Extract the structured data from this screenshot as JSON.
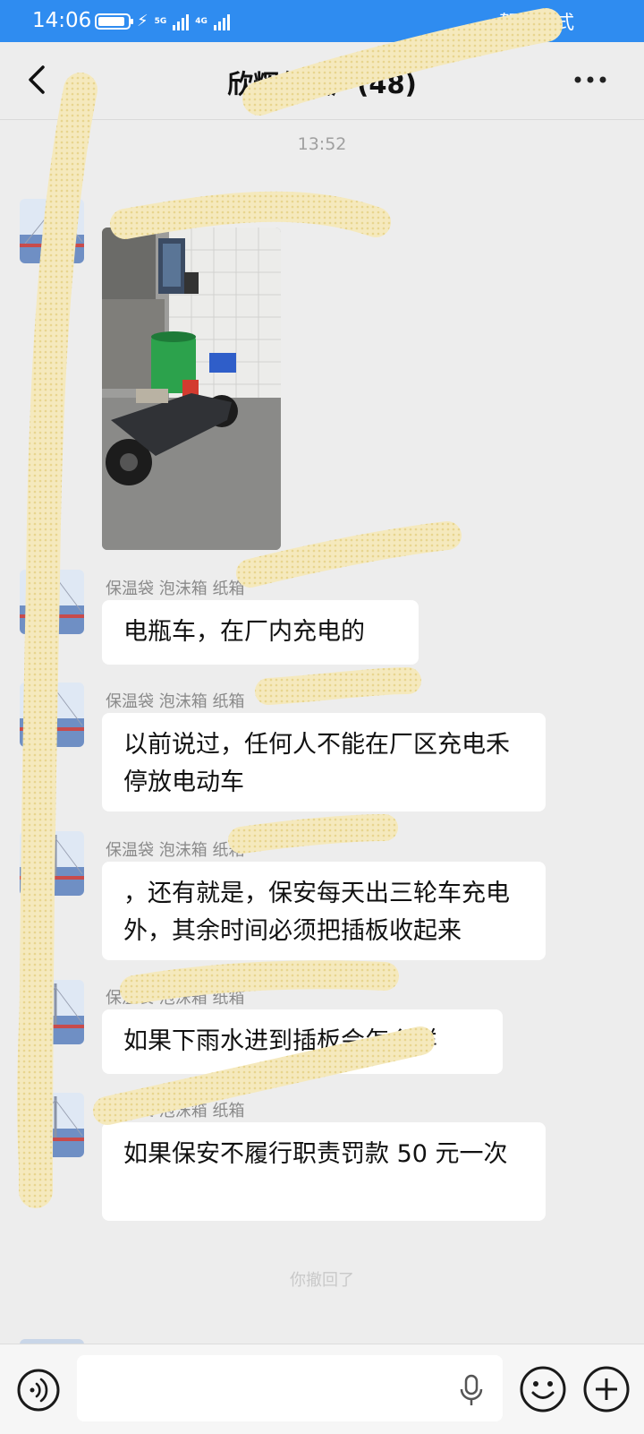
{
  "status_bar": {
    "time": "14:06",
    "network_1": "5G",
    "network_2": "4G",
    "mode": "驾驶模式"
  },
  "header": {
    "title": "欣辉包装厂(48)"
  },
  "chat": {
    "timestamp": "13:52",
    "sender_name": "保温袋 泡沫箱 纸箱",
    "messages": [
      {
        "text": "电瓶车，在厂内充电的"
      },
      {
        "text": "以前说过，任何人不能在厂区充电禾停放电动车"
      },
      {
        "text": "，还有就是，保安每天出三轮车充电外，其余时间必须把插板收起来"
      },
      {
        "text": "如果下雨水进到插板会怎么样"
      },
      {
        "text": "如果保安不履行职责罚款 50 元一次"
      }
    ],
    "recall_notice": "你撤回了"
  },
  "input": {
    "value": "",
    "placeholder": ""
  },
  "icons": {
    "back": "back-arrow-icon",
    "more": "more-dots-icon",
    "voice": "voice-icon",
    "mic": "microphone-icon",
    "emoji": "emoji-icon",
    "plus": "plus-icon"
  },
  "colors": {
    "status_bar": "#2f8cf0",
    "background": "#ededed",
    "bubble": "#ffffff",
    "redaction": "#f4e6b4"
  }
}
